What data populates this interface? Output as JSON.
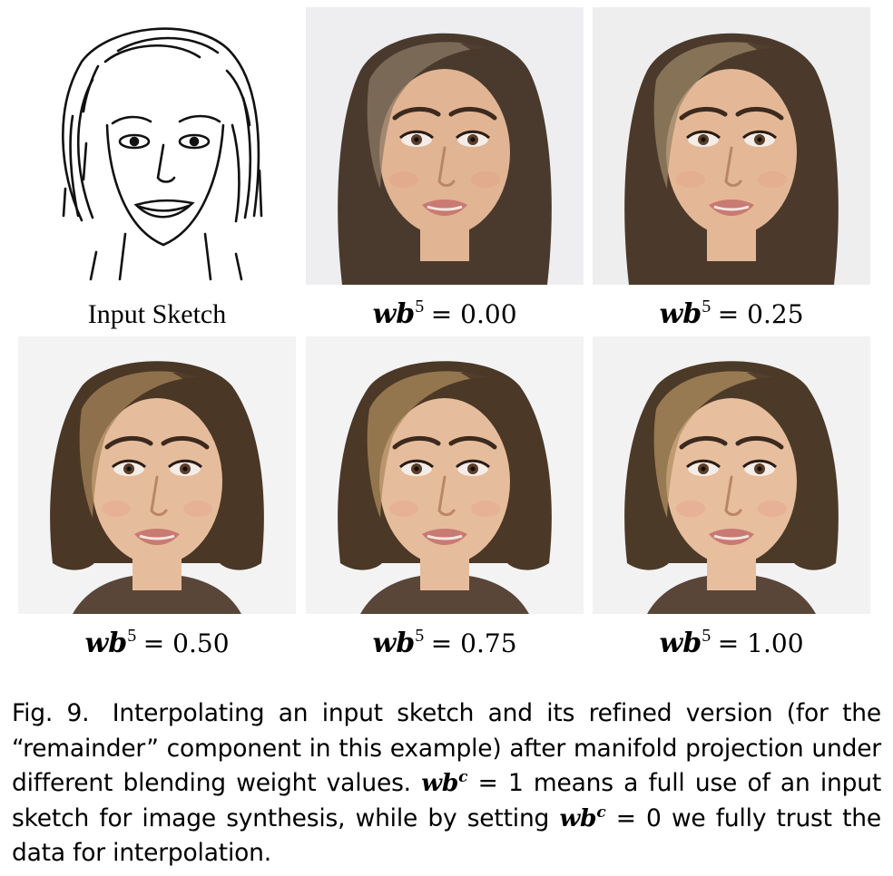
{
  "figure": {
    "panels": [
      {
        "id": "sketch",
        "label_text": "Input Sketch",
        "hair": "short-sketch",
        "colors": {
          "line": "#111111",
          "bg": "#ffffff"
        }
      },
      {
        "id": "p000",
        "var": "wb",
        "sup": "5",
        "eq": "= 0.00",
        "hair": "long",
        "colors": {
          "hair": "#4a3a2e",
          "hair_light": "#8c7a66",
          "skin": "#e1b493",
          "bg": "#eeeef0"
        }
      },
      {
        "id": "p025",
        "var": "wb",
        "sup": "5",
        "eq": "= 0.25",
        "hair": "long",
        "colors": {
          "hair": "#4b3a2c",
          "hair_light": "#9a8566",
          "skin": "#e4b896",
          "bg": "#eeeeef"
        }
      },
      {
        "id": "p050",
        "var": "wb",
        "sup": "5",
        "eq": "= 0.50",
        "hair": "bob",
        "colors": {
          "hair": "#4a3726",
          "hair_light": "#a58459",
          "skin": "#e6bd9c",
          "bg": "#f3f3f4"
        }
      },
      {
        "id": "p075",
        "var": "wb",
        "sup": "5",
        "eq": "= 0.75",
        "hair": "bob",
        "colors": {
          "hair": "#4b3827",
          "hair_light": "#ab8a5c",
          "skin": "#e6bd9c",
          "bg": "#f3f3f4"
        }
      },
      {
        "id": "p100",
        "var": "wb",
        "sup": "5",
        "eq": "= 1.00",
        "hair": "bob",
        "colors": {
          "hair": "#4c3a28",
          "hair_light": "#b08f60",
          "skin": "#e7be9e",
          "bg": "#f2f2f3"
        }
      }
    ]
  },
  "caption": {
    "fig_label": "Fig. 9.",
    "part1": "Interpolating an input sketch and its refined version (for the “remainder” component in this example) after manifold projection under different blending weight values.",
    "math1_var": "wb",
    "math1_sup": "c",
    "part2": "= 1 means a full use of an input sketch for image synthesis, while by setting",
    "math2_var": "wb",
    "math2_sup": "c",
    "part3": "= 0 we fully trust the data for interpolation."
  }
}
